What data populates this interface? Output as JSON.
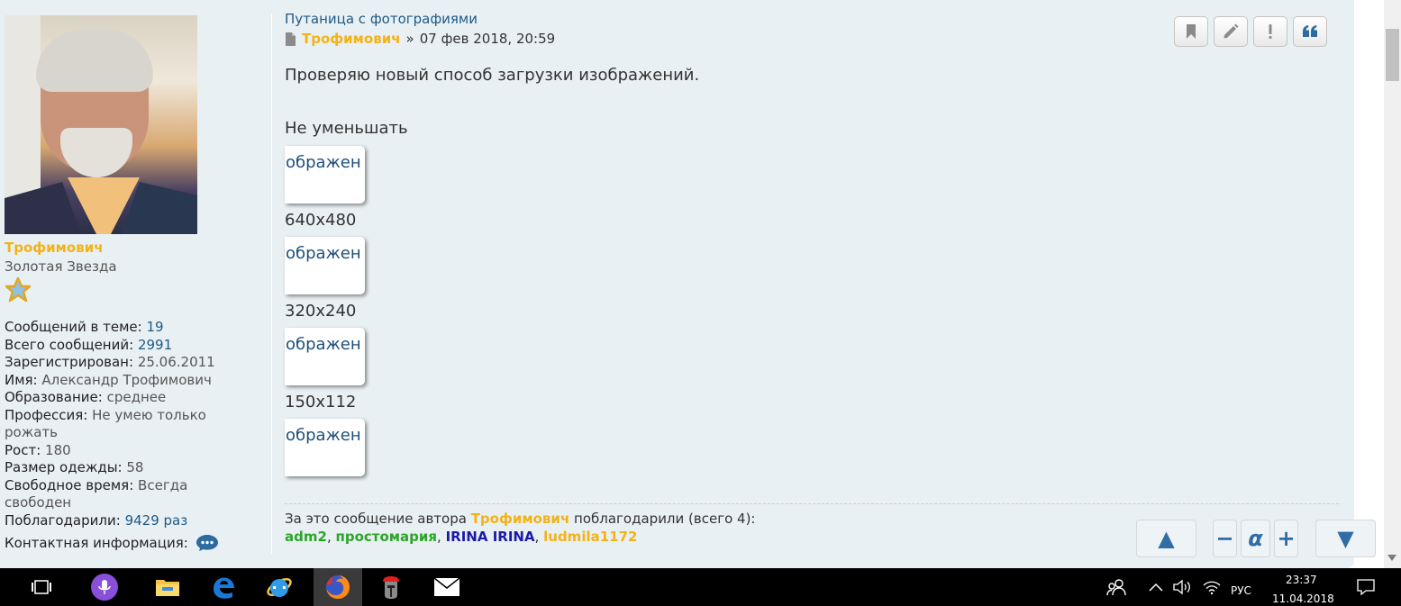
{
  "post": {
    "topic_title": "Путаница с фотографиями",
    "author": "Трофимович",
    "date_sep": "»",
    "date": "07 фев 2018, 20:59",
    "body_line": "Проверяю новый способ загрузки изображений.",
    "subheading": "Не уменьшать",
    "thumb_text": "ображен",
    "sizes": [
      "640x480",
      "320x240",
      "150x112"
    ],
    "actions": [
      {
        "name": "bookmark-icon"
      },
      {
        "name": "edit-icon"
      },
      {
        "name": "report-icon",
        "glyph": "!"
      },
      {
        "name": "quote-icon"
      }
    ]
  },
  "profile": {
    "username": "Трофимович",
    "rank": "Золотая Звезда",
    "fields": [
      {
        "label": "Сообщений в теме:",
        "value": "19"
      },
      {
        "label": "Всего сообщений:",
        "value": "2991"
      },
      {
        "label": "Зарегистрирован:",
        "value": "25.06.2011"
      },
      {
        "label": "Имя:",
        "value": "Александр Трофимович"
      },
      {
        "label": "Образование:",
        "value": "среднее"
      },
      {
        "label": "Профессия:",
        "value": "Не умею только рожать"
      },
      {
        "label": "Рост:",
        "value": "180"
      },
      {
        "label": "Размер одежды:",
        "value": "58"
      },
      {
        "label": "Свободное время:",
        "value": "Всегда свободен"
      },
      {
        "label": "Поблагодарили:",
        "value": "9429 раз"
      }
    ],
    "contact_label": "Контактная информация:"
  },
  "thanks": {
    "prefix": "За это сообщение автора",
    "author": "Трофимович",
    "suffix": "поблагодарили (всего 4):",
    "users": [
      {
        "name": "adm2",
        "color": "#2ea52a"
      },
      {
        "name": "простомария",
        "color": "#2ea52a"
      },
      {
        "name": "IRINA IRINA",
        "color": "#1a1aa6"
      },
      {
        "name": "ludmila1172",
        "color": "#f2b317"
      }
    ],
    "separator": ", "
  },
  "nav": {
    "up": "▲",
    "minus": "−",
    "alpha": "α",
    "plus": "+",
    "down": "▼"
  },
  "taskbar": {
    "language": "РУС",
    "time": "23:37",
    "date": "11.04.2018"
  },
  "colors": {
    "accent_link": "#1e5a86",
    "author_gold": "#f2b317",
    "post_bg": "#e9f0f4"
  }
}
